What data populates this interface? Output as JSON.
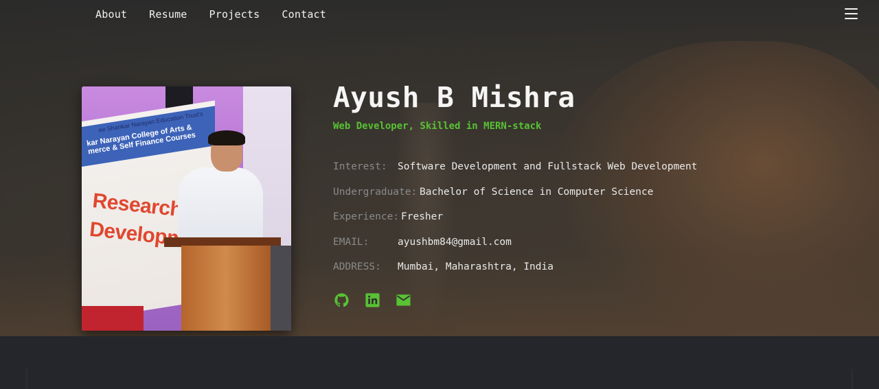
{
  "nav": {
    "links": [
      "About",
      "Resume",
      "Projects",
      "Contact"
    ],
    "menu_icon": "hamburger-menu-icon"
  },
  "profile": {
    "name": "Ayush B Mishra",
    "tagline": "Web Developer, Skilled in MERN-stack",
    "photo": {
      "banner_line1": "ee Shankar Narayan Education Trust's",
      "banner_line2": "kar Narayan College of Arts &",
      "banner_line3": "merce & Self Finance Courses",
      "sign_line1": "Research",
      "sign_line2": "Developme"
    },
    "details": [
      {
        "label": "Interest:",
        "value": "Software Development and Fullstack Web Development"
      },
      {
        "label": "Undergraduate:",
        "value": "Bachelor of Science in Computer Science"
      },
      {
        "label": "Experience:",
        "value": "Fresher"
      },
      {
        "label": "EMAIL:",
        "value": "ayushbm84@gmail.com"
      },
      {
        "label": "ADDRESS:",
        "value": "Mumbai, Maharashtra, India"
      }
    ],
    "socials": [
      {
        "icon": "github-icon"
      },
      {
        "icon": "linkedin-icon"
      },
      {
        "icon": "email-icon"
      }
    ]
  },
  "colors": {
    "accent": "#58c234",
    "label": "#8a8a8a",
    "text": "#eaeaea",
    "background": "#23252a"
  }
}
